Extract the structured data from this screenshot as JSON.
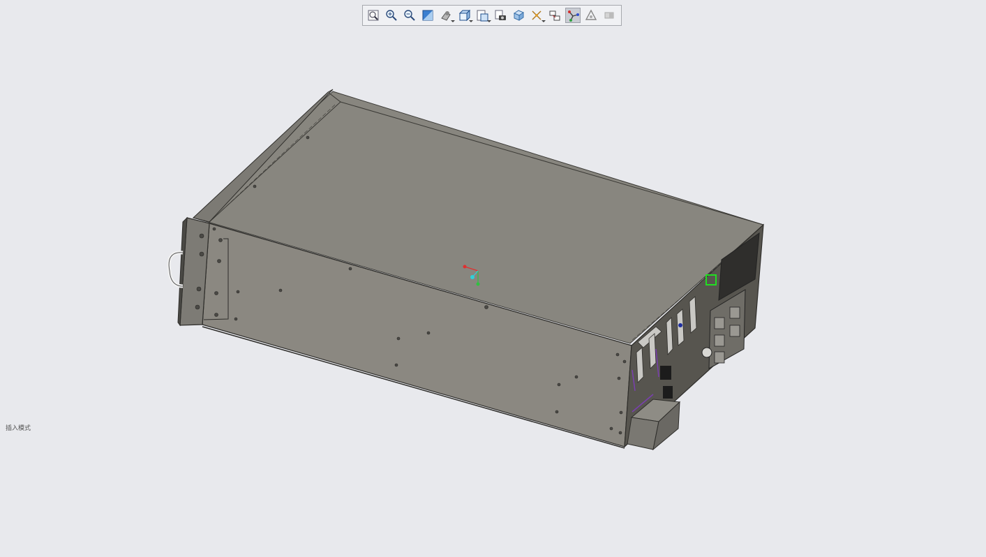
{
  "toolbar": {
    "tools": [
      {
        "name": "zoom-to-fit",
        "icon": "zoom-fit-icon",
        "dropdown": false,
        "active": false
      },
      {
        "name": "zoom-in",
        "icon": "zoom-in-icon",
        "dropdown": false,
        "active": false
      },
      {
        "name": "zoom-out",
        "icon": "zoom-out-icon",
        "dropdown": false,
        "active": false
      },
      {
        "name": "section-view",
        "icon": "section-view-icon",
        "dropdown": false,
        "active": false
      },
      {
        "name": "view-orientation",
        "icon": "view-orientation-icon",
        "dropdown": true,
        "active": false
      },
      {
        "name": "display-style",
        "icon": "display-style-icon",
        "dropdown": true,
        "active": false
      },
      {
        "name": "view-settings",
        "icon": "view-settings-icon",
        "dropdown": true,
        "active": false
      },
      {
        "name": "camera",
        "icon": "camera-icon",
        "dropdown": false,
        "active": false
      },
      {
        "name": "3d-view",
        "icon": "3d-view-icon",
        "dropdown": false,
        "active": false
      },
      {
        "name": "explode",
        "icon": "explode-icon",
        "dropdown": true,
        "active": false
      },
      {
        "name": "hide-show",
        "icon": "hide-show-icon",
        "dropdown": false,
        "active": false
      },
      {
        "name": "triad",
        "icon": "triad-icon",
        "dropdown": false,
        "active": true
      },
      {
        "name": "render",
        "icon": "render-icon",
        "dropdown": false,
        "active": false
      },
      {
        "name": "disabled-tool",
        "icon": "disabled-tool-icon",
        "dropdown": false,
        "active": false
      }
    ]
  },
  "status": {
    "mode_label": "插入模式"
  },
  "colors": {
    "background": "#e8e9ed",
    "model_top": "#88867f",
    "model_side": "#8a8780",
    "model_front": "#57554f",
    "edge": "#2e2d2a",
    "triad_x": "#e03030",
    "triad_y": "#30c040",
    "triad_z": "#30d0d8",
    "port_highlight": "#22dd22",
    "purple_accent": "#7a3fb0"
  }
}
